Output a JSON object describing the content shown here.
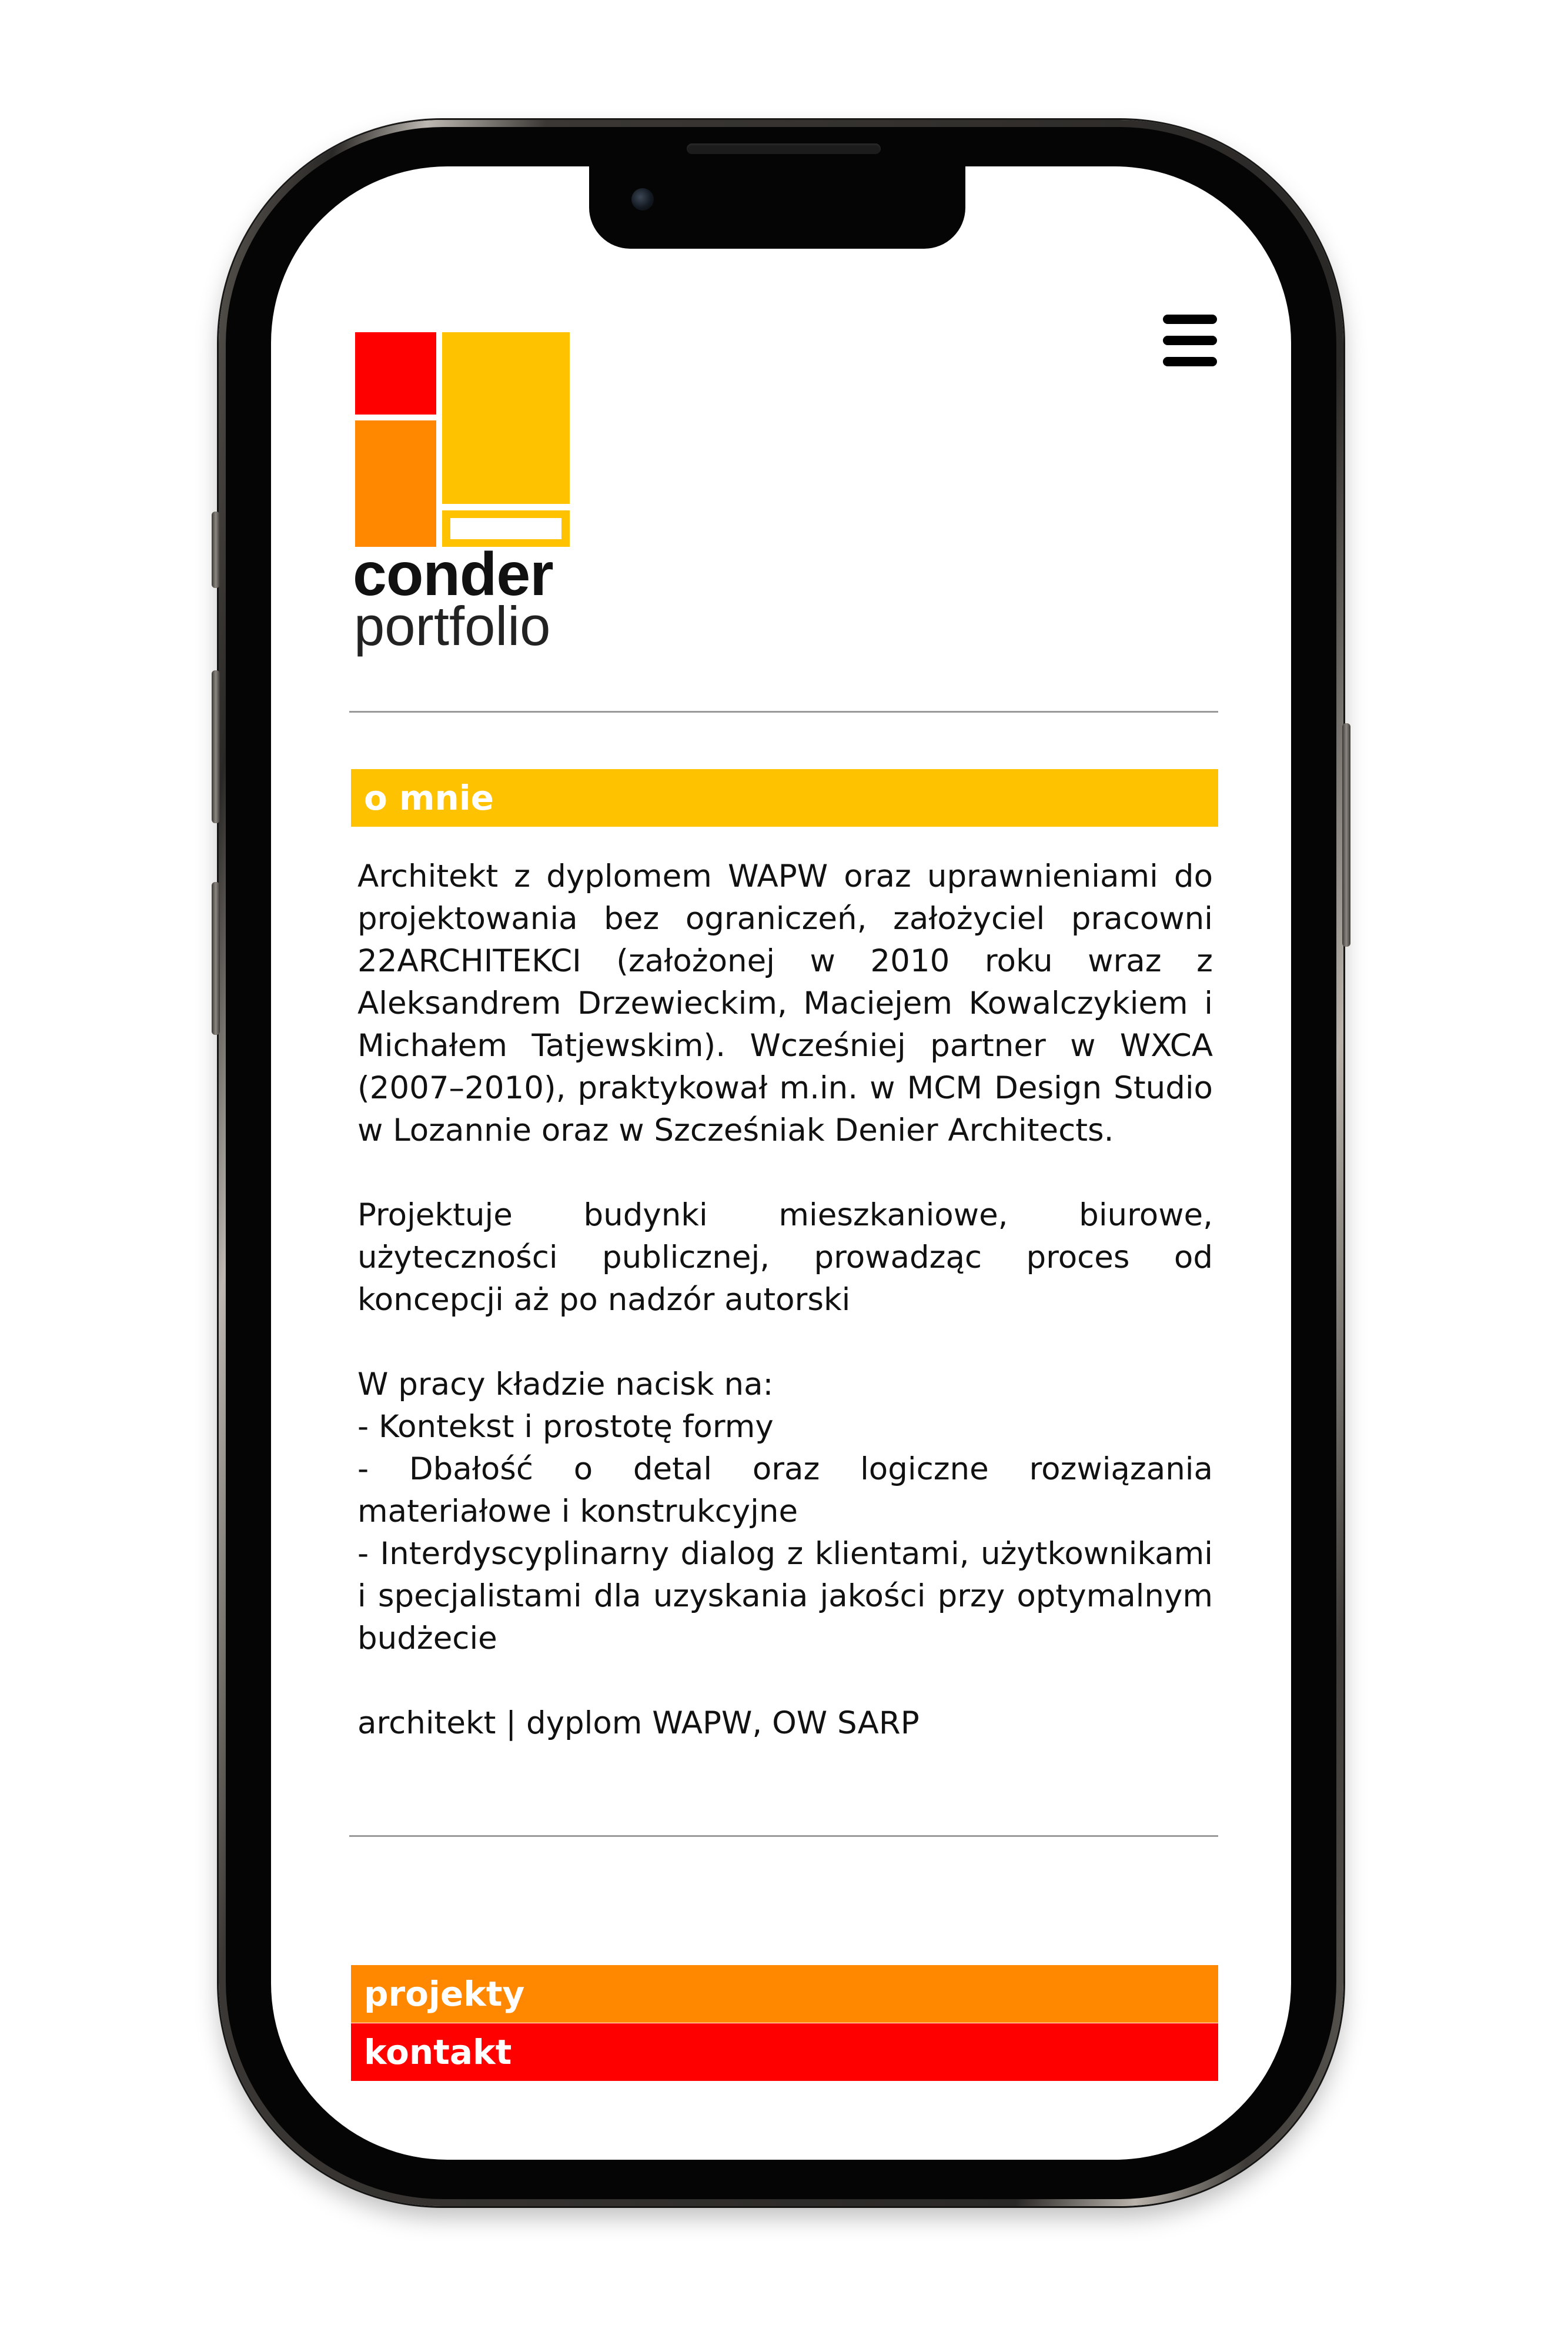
{
  "brand": {
    "name": "conder",
    "subtitle": "portfolio",
    "colors": {
      "red": "#ff0000",
      "orange": "#ff8800",
      "yellow": "#ffc200"
    }
  },
  "header": {
    "menu_icon": "hamburger-menu-icon"
  },
  "about": {
    "heading": "o mnie",
    "paragraph_1": "Architekt z dyplomem WAPW oraz uprawnieniami do projektowania bez ograniczeń, założyciel pracowni 22ARCHITEKCI (założonej w 2010 roku wraz z Aleksandrem Drzewieckim, Maciejem Kowalczykiem i Michałem Tatjewskim). Wcześniej partner w WXCA (2007–2010), praktykował m.in. w MCM Design Studio w Lozannie oraz w Szcześniak Denier Architects.",
    "paragraph_2": "Projektuje budynki mieszkaniowe, biurowe, użyteczności publicznej, prowadząc proces od koncepcji aż po nadzór autorski",
    "focus_heading": "W pracy kładzie nacisk na:",
    "focus_items": [
      "- Kontekst i prostotę formy",
      "- Dbałość o detal oraz logiczne rozwiązania materiałowe i konstrukcyjne",
      "- Interdyscyplinarny dialog z klientami, użytkownikami i specjalistami dla uzyskania jakości przy optymalnym budżecie"
    ],
    "credentials": "architekt | dyplom WAPW, OW SARP"
  },
  "nav": {
    "projects_label": "projekty",
    "contact_label": "kontakt"
  }
}
